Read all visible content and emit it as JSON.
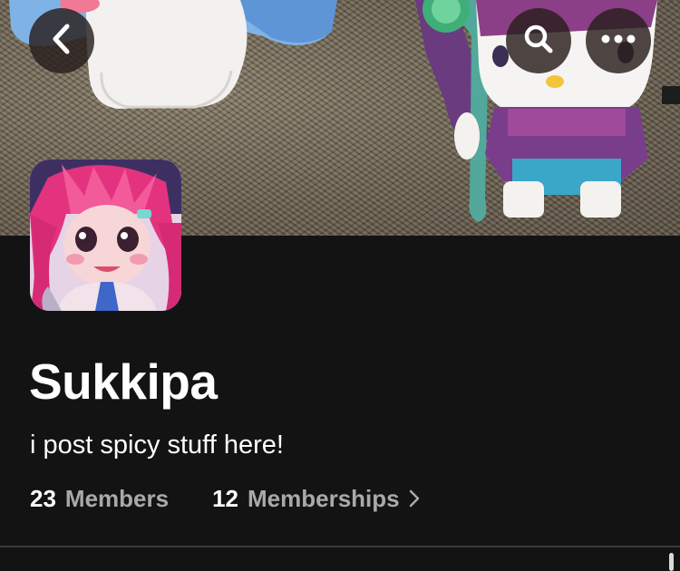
{
  "header": {
    "back_icon": "chevron-left-icon",
    "search_icon": "search-icon",
    "more_icon": "more-horizontal-icon"
  },
  "profile": {
    "name": "Sukkipa",
    "bio": "i post spicy stuff here!",
    "stats": {
      "members_count": "23",
      "members_label": "Members",
      "memberships_count": "12",
      "memberships_label": "Memberships"
    }
  },
  "colors": {
    "background": "#131313",
    "text_primary": "#ffffff",
    "text_secondary": "#a9a9a9",
    "button_background": "#281e1c"
  }
}
